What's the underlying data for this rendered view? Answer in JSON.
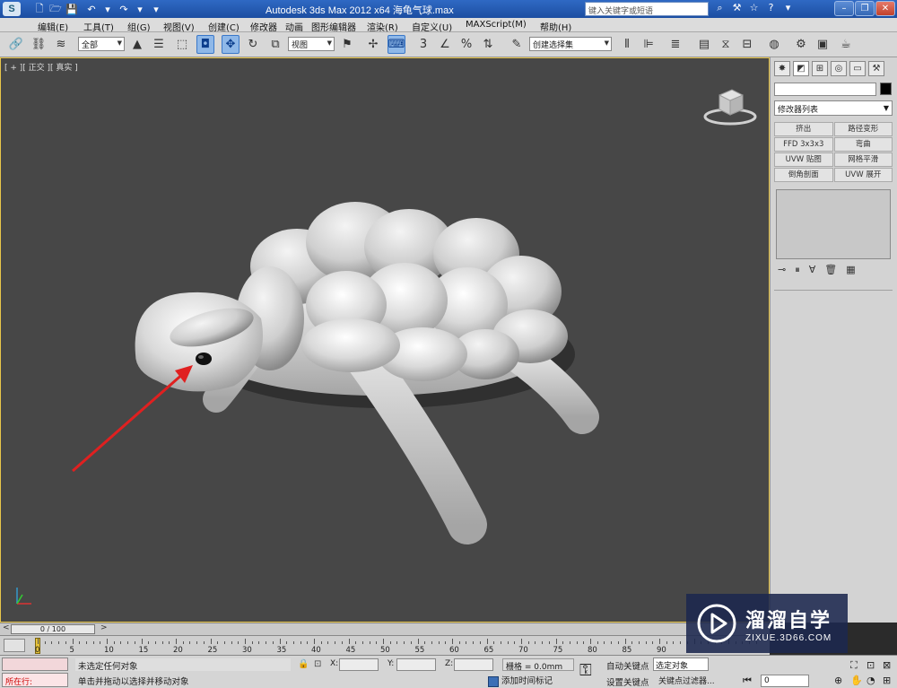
{
  "window": {
    "title": "Autodesk 3ds Max  2012 x64     海龟气球.max",
    "search_placeholder": "键入关键字或短语",
    "app_logo": "S"
  },
  "menu": [
    "编辑(E)",
    "工具(T)",
    "组(G)",
    "视图(V)",
    "创建(C)",
    "修改器",
    "动画",
    "图形编辑器",
    "渲染(R)",
    "自定义(U)",
    "MAXScript(M)",
    "帮助(H)"
  ],
  "toolbar": {
    "selection_filter": "全部",
    "ref_coord": "视图",
    "named_selection": "创建选择集"
  },
  "viewport": {
    "label": "[ + ][ 正交 ][ 真实 ]",
    "border_color": "#e8c64a",
    "annotation_arrow_color": "#e02020"
  },
  "command_panel": {
    "modifier_list": "修改器列表",
    "modifiers": [
      "挤出",
      "路径变形",
      "FFD 3x3x3",
      "弯曲",
      "UVW 贴图",
      "网格平滑",
      "倒角剖面",
      "UVW 展开"
    ]
  },
  "timeslider": {
    "position": "0 / 100",
    "ticks": [
      "0",
      "5",
      "10",
      "15",
      "20",
      "25",
      "30",
      "35",
      "40",
      "45",
      "50",
      "55",
      "60",
      "65",
      "70",
      "75",
      "80",
      "85",
      "90"
    ]
  },
  "status": {
    "script_label": "所在行:",
    "selection_msg": "未选定任何对象",
    "prompt_msg": "单击并拖动以选择并移动对象",
    "x_label": "X:",
    "y_label": "Y:",
    "z_label": "Z:",
    "grid": "栅格 = 0.0mm",
    "add_time_tag": "添加时间标记",
    "auto_key": "自动关键点",
    "set_key": "设置关键点",
    "selected_dropdown": "选定对象",
    "key_filters": "关键点过滤器...",
    "frame": "0"
  },
  "watermark": {
    "brand": "溜溜自学",
    "url": "ZIXUE.3D66.COM"
  }
}
